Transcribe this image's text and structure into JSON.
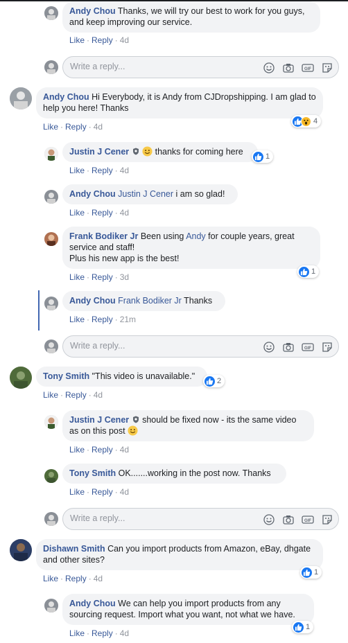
{
  "colors": {
    "link": "#385898",
    "like_blue": "#1877f2",
    "bubble": "#f2f3f5",
    "muted": "#90949c"
  },
  "labels": {
    "like": "Like",
    "reply": "Reply",
    "dot": "·"
  },
  "reply_placeholder": "Write a reply...",
  "comments": [
    {
      "author": "Andy Chou",
      "text": "Thanks, we will try our best to work for you guys, and keep improving our service.",
      "time": "4d"
    },
    {
      "author": "Andy Chou",
      "text": "Hi Everybody, it is Andy from CJDropshipping. I am glad to help you here! Thanks",
      "time": "4d",
      "reactions": "4"
    },
    {
      "author": "Justin J Cener",
      "text": "thanks for coming here",
      "time": "4d",
      "reactions": "1"
    },
    {
      "author": "Andy Chou",
      "mention": "Justin J Cener",
      "text": "i am so glad!",
      "time": "4d"
    },
    {
      "author": "Frank Bodiker Jr",
      "text_a": "Been using",
      "mention": "Andy",
      "text_b": "for couple years, great service and staff!",
      "text_c": "Plus his new app is the best!",
      "time": "3d",
      "reactions": "1"
    },
    {
      "author": "Andy Chou",
      "mention": "Frank Bodiker Jr",
      "text": "Thanks",
      "time": "21m"
    },
    {
      "author": "Tony Smith",
      "text": "\"This video is unavailable.\"",
      "time": "4d",
      "reactions": "2"
    },
    {
      "author": "Justin J Cener",
      "text": "should be fixed now - its the same video as on this post",
      "time": "4d"
    },
    {
      "author": "Tony Smith",
      "text": "OK.......working in the post now. Thanks",
      "time": "4d"
    },
    {
      "author": "Dishawn Smith",
      "text": "Can you import products from Amazon, eBay, dhgate and other sites?",
      "time": "4d",
      "reactions": "1"
    },
    {
      "author": "Andy Chou",
      "text": "We can help you import products from any sourcing request. Import what you want, not what we have.",
      "time": "4d",
      "reactions": "1"
    }
  ]
}
